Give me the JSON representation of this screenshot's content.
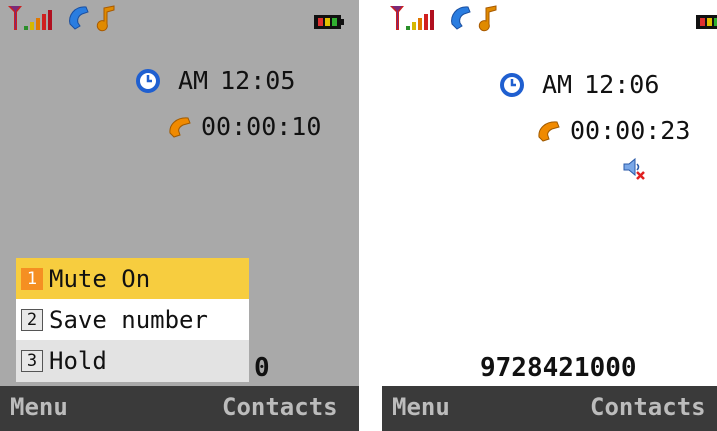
{
  "left_screen": {
    "status_icons": [
      "signal-icon",
      "call-icon",
      "music-icon",
      "battery-icon"
    ],
    "clock_period": "AM",
    "clock_time": "12:05",
    "call_timer": "00:00:10",
    "dialed_number_fragment": "0",
    "popup_menu": [
      {
        "num": "1",
        "label": "Mute On",
        "selected": true
      },
      {
        "num": "2",
        "label": "Save number",
        "selected": false
      },
      {
        "num": "3",
        "label": "Hold",
        "selected": false
      }
    ],
    "softkeys": {
      "left": "Menu",
      "right": "Contacts"
    }
  },
  "right_screen": {
    "status_icons": [
      "signal-icon",
      "call-icon",
      "music-icon",
      "battery-icon"
    ],
    "clock_period": "AM",
    "clock_time": "12:06",
    "call_timer": "00:00:23",
    "mute_icon": "speaker-muted-icon",
    "dialed_number": "9728421000",
    "softkeys": {
      "left": "Menu",
      "right": "Contacts"
    }
  },
  "colors": {
    "left_bg": "#a9a9a9",
    "right_bg": "#ffffff",
    "softkey_bar": "#3a3a3a",
    "softkey_text": "#bcbcbc",
    "menu_highlight": "#f7cd3f",
    "menu_number_highlight": "#f58f22"
  }
}
